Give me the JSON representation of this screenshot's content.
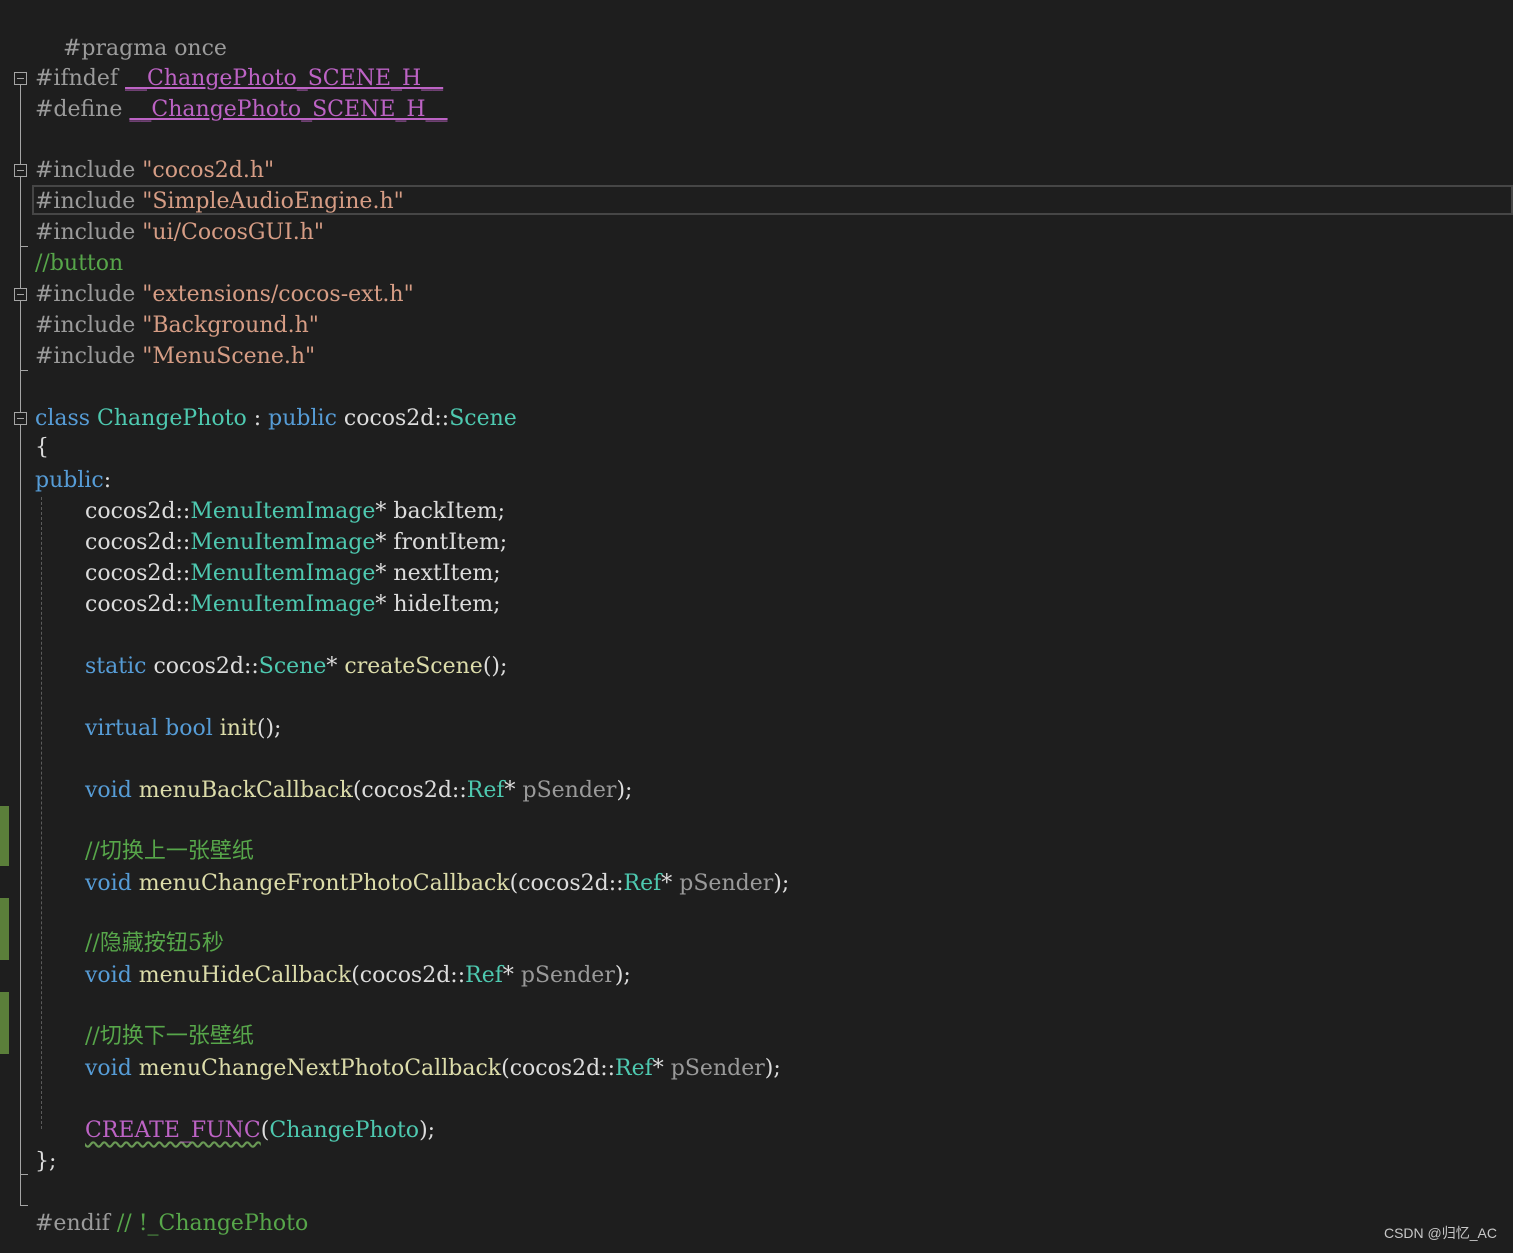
{
  "editor": {
    "lines": {
      "l1": {
        "a": "#pragma once"
      },
      "l2": {
        "a": "#ifndef ",
        "b": "__ChangePhoto_SCENE_H__"
      },
      "l3": {
        "a": "#define ",
        "b": "__ChangePhoto_SCENE_H__"
      },
      "l4": {
        "a": "#include ",
        "b": "\"cocos2d.h\""
      },
      "l5": {
        "a": "#include ",
        "b": "\"SimpleAudioEngine.h\""
      },
      "l6": {
        "a": "#include ",
        "b": "\"ui/CocosGUI.h\""
      },
      "l7": {
        "a": "//button"
      },
      "l8": {
        "a": "#include ",
        "b": "\"extensions/cocos-ext.h\""
      },
      "l9": {
        "a": "#include ",
        "b": "\"Background.h\""
      },
      "l10": {
        "a": "#include ",
        "b": "\"MenuScene.h\""
      },
      "l11": {
        "a": "class ",
        "b": "ChangePhoto",
        "c": " : ",
        "d": "public",
        "e": " cocos2d::",
        "f": "Scene"
      },
      "l12": {
        "a": "{"
      },
      "l13": {
        "a": "public",
        "b": ":"
      },
      "l14": {
        "a": "cocos2d::",
        "b": "MenuItemImage",
        "c": "* backItem;"
      },
      "l15": {
        "a": "cocos2d::",
        "b": "MenuItemImage",
        "c": "* frontItem;"
      },
      "l16": {
        "a": "cocos2d::",
        "b": "MenuItemImage",
        "c": "* nextItem;"
      },
      "l17": {
        "a": "cocos2d::",
        "b": "MenuItemImage",
        "c": "* hideItem;"
      },
      "l18": {
        "a": "static",
        "b": " cocos2d::",
        "c": "Scene",
        "d": "* ",
        "e": "createScene",
        "f": "();"
      },
      "l19": {
        "a": "virtual",
        "b": " ",
        "c": "bool",
        "d": " ",
        "e": "init",
        "f": "();"
      },
      "l20": {
        "a": "void",
        "b": " ",
        "c": "menuBackCallback",
        "d": "(cocos2d::",
        "e": "Ref",
        "f": "* ",
        "g": "pSender",
        "h": ");"
      },
      "l21": {
        "a": "//切换上一张壁纸"
      },
      "l22": {
        "a": "void",
        "b": " ",
        "c": "menuChangeFrontPhotoCallback",
        "d": "(cocos2d::",
        "e": "Ref",
        "f": "* ",
        "g": "pSender",
        "h": ");"
      },
      "l23": {
        "a": "//隐藏按钮5秒"
      },
      "l24": {
        "a": "void",
        "b": " ",
        "c": "menuHideCallback",
        "d": "(cocos2d::",
        "e": "Ref",
        "f": "* ",
        "g": "pSender",
        "h": ");"
      },
      "l25": {
        "a": "//切换下一张壁纸"
      },
      "l26": {
        "a": "void",
        "b": " ",
        "c": "menuChangeNextPhotoCallback",
        "d": "(cocos2d::",
        "e": "Ref",
        "f": "* ",
        "g": "pSender",
        "h": ");"
      },
      "l27": {
        "a": "CREATE_FUNC",
        "b": "(",
        "c": "ChangePhoto",
        "d": ");"
      },
      "l28": {
        "a": "};"
      },
      "l29": {
        "a": "#endif ",
        "b": "// !_ChangePhoto"
      }
    }
  },
  "watermark": "CSDN @归忆_AC",
  "colors": {
    "background": "#1e1e1e",
    "preprocessor": "#9b9b9b",
    "macro": "#bd63c5",
    "string": "#d69d85",
    "comment": "#57a64a",
    "keyword": "#569cd6",
    "type": "#4ec9b0",
    "function": "#dcdcaa",
    "change_bar": "#5b7f3a"
  }
}
